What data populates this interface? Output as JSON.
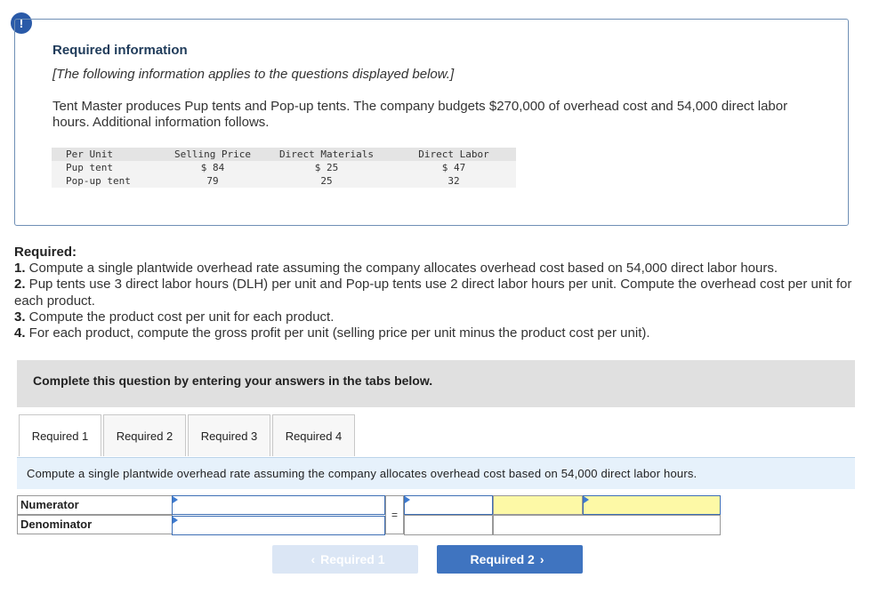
{
  "alert_icon": "!",
  "info": {
    "title": "Required information",
    "subtitle": "[The following information applies to the questions displayed below.]",
    "paragraph": "Tent Master produces Pup tents and Pop-up tents. The company budgets $270,000 of overhead cost and 54,000 direct labor hours. Additional information follows."
  },
  "table": {
    "headers": [
      "Per Unit",
      "Selling Price",
      "Direct Materials",
      "Direct Labor"
    ],
    "rows": [
      [
        "Pup tent",
        "$ 84",
        "$ 25",
        "$ 47"
      ],
      [
        "Pop-up tent",
        "79",
        "25",
        "32"
      ]
    ]
  },
  "required": {
    "heading": "Required:",
    "items": [
      {
        "num": "1.",
        "text": " Compute a single plantwide overhead rate assuming the company allocates overhead cost based on 54,000 direct labor hours."
      },
      {
        "num": "2.",
        "text": " Pup tents use 3 direct labor hours (DLH) per unit and Pop-up tents use 2 direct labor hours per unit. Compute the overhead cost per unit for each product."
      },
      {
        "num": "3.",
        "text": " Compute the product cost per unit for each product."
      },
      {
        "num": "4.",
        "text": " For each product, compute the gross profit per unit (selling price per unit minus the product cost per unit)."
      }
    ]
  },
  "complete_bar": "Complete this question by entering your answers in the tabs below.",
  "tabs": [
    "Required 1",
    "Required 2",
    "Required 3",
    "Required 4"
  ],
  "active_tab": "Required 1",
  "panel_instruction": "Compute a single plantwide overhead rate assuming the company allocates overhead cost based on 54,000 direct labor hours.",
  "form": {
    "numerator_label": "Numerator",
    "denominator_label": "Denominator",
    "equals": "=",
    "numerator_value": "",
    "denominator_value": "",
    "result_value": "",
    "rate_value": ""
  },
  "nav": {
    "prev_label": "Required 1",
    "next_label": "Required 2",
    "prev_icon": "chevron-left-icon",
    "next_icon": "chevron-right-icon"
  },
  "colors": {
    "accent": "#3f74c0",
    "highlight": "#fdf9a6",
    "panel_band": "#e6f1fb"
  }
}
